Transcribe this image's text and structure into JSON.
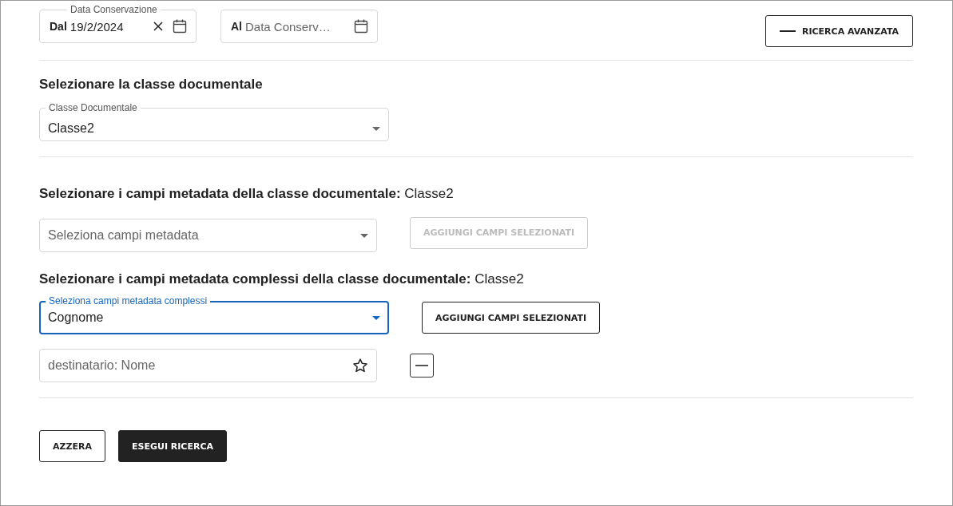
{
  "date_range": {
    "from": {
      "label": "Data Conservazione",
      "prefix": "Dal",
      "value": "19/2/2024"
    },
    "to": {
      "prefix": "Al",
      "placeholder": "Data Conserv…"
    }
  },
  "advanced_search_button": {
    "label": "RICERCA AVANZATA"
  },
  "class_section": {
    "heading": "Selezionare la classe documentale",
    "select": {
      "label": "Classe Documentale",
      "value": "Classe2",
      "focused": false
    }
  },
  "metadata_section": {
    "heading": "**Selezionare i campi metadata della classe documentale:** Classe2",
    "select": {
      "placeholder": "Seleziona campi metadata",
      "focused": false
    },
    "add_button": {
      "label": "AGGIUNGI CAMPI SELEZIONATI",
      "disabled": true
    }
  },
  "complex_section": {
    "heading": "**Selezionare i campi metadata complessi della classe documentale:** Classe2",
    "select": {
      "label": "Seleziona campi metadata complessi",
      "value": "Cognome",
      "focused": true
    },
    "add_button": {
      "label": "AGGIUNGI CAMPI SELEZIONATI",
      "disabled": false
    }
  },
  "fields": [
    {
      "placeholder": "destinatario: Nome",
      "starred": false
    }
  ],
  "actions": {
    "reset": "AZZERA",
    "search": "ESEGUI RICERCA"
  }
}
